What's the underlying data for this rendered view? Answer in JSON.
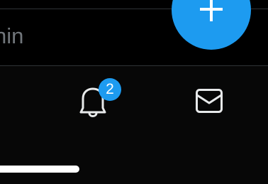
{
  "timeline": {
    "partial_text": "nin"
  },
  "compose": {
    "icon": "plus-icon",
    "color": "#1d9bf0"
  },
  "bottom_nav": {
    "notifications": {
      "icon": "bell-icon",
      "badge_count": "2"
    },
    "messages": {
      "icon": "envelope-icon"
    }
  },
  "colors": {
    "background": "#000000",
    "accent": "#1d9bf0",
    "muted_text": "#71767b",
    "icon": "#e7e9ea"
  }
}
